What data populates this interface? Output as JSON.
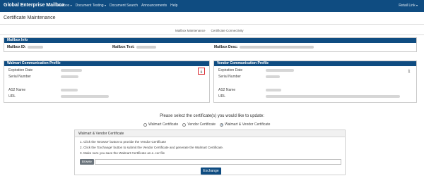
{
  "topbar": {
    "brand": "Global Enterprise Mailbox",
    "nav": [
      {
        "label": "Mailbox",
        "has_caret": true
      },
      {
        "label": "Document Testing",
        "has_caret": true
      },
      {
        "label": "Document Search",
        "has_caret": false
      },
      {
        "label": "Announcements",
        "has_caret": false
      },
      {
        "label": "Help",
        "has_caret": false
      }
    ],
    "user_label": "Retail Link"
  },
  "page": {
    "title": "Certificate Maintenance"
  },
  "subtabs": {
    "mailbox_maintenance": "Mailbox Maintenance",
    "certificate_connectivity": "Certificate Connectivity"
  },
  "mailbox_info": {
    "header": "Mailbox Info",
    "id_label": "Mailbox ID:",
    "text_label": "Mailbox Text:",
    "desc_label": "Mailbox Desc:"
  },
  "walmart_profile": {
    "header": "Walmart Communication Profile",
    "expiration_label": "Expiration Date",
    "serial_label": "Serial Number",
    "as2_label": "AS2 Name",
    "url_label": "URL"
  },
  "vendor_profile": {
    "header": "Vendor Communication Profile",
    "expiration_label": "Expiration Date",
    "serial_label": "Serial Number",
    "as2_label": "AS2 Name",
    "url_label": "URL"
  },
  "selection": {
    "question": "Please select the certificate(s) you would like to update:",
    "options": [
      {
        "label": "Walmart Certificate",
        "selected": false
      },
      {
        "label": "Vendor Certificate",
        "selected": false
      },
      {
        "label": "Walmart & Vendor Certificate",
        "selected": true
      }
    ]
  },
  "instructions": {
    "header": "Walmart & Vendor Certificate",
    "step1": "1. Click the 'Browse' button to provide the Vendor Certificate",
    "step2": "2. Click the 'Exchange' button to submit the Vendor Certificate and generate the Walmart Certificate.",
    "step3": "3. Make sure you save the Walmart Certificate as a .cer file",
    "browse_label": "Browse",
    "exchange_label": "Exchange"
  },
  "colors": {
    "primary": "#0f4c81",
    "highlight": "#d9282f"
  },
  "icons": {
    "download": "download-icon"
  }
}
